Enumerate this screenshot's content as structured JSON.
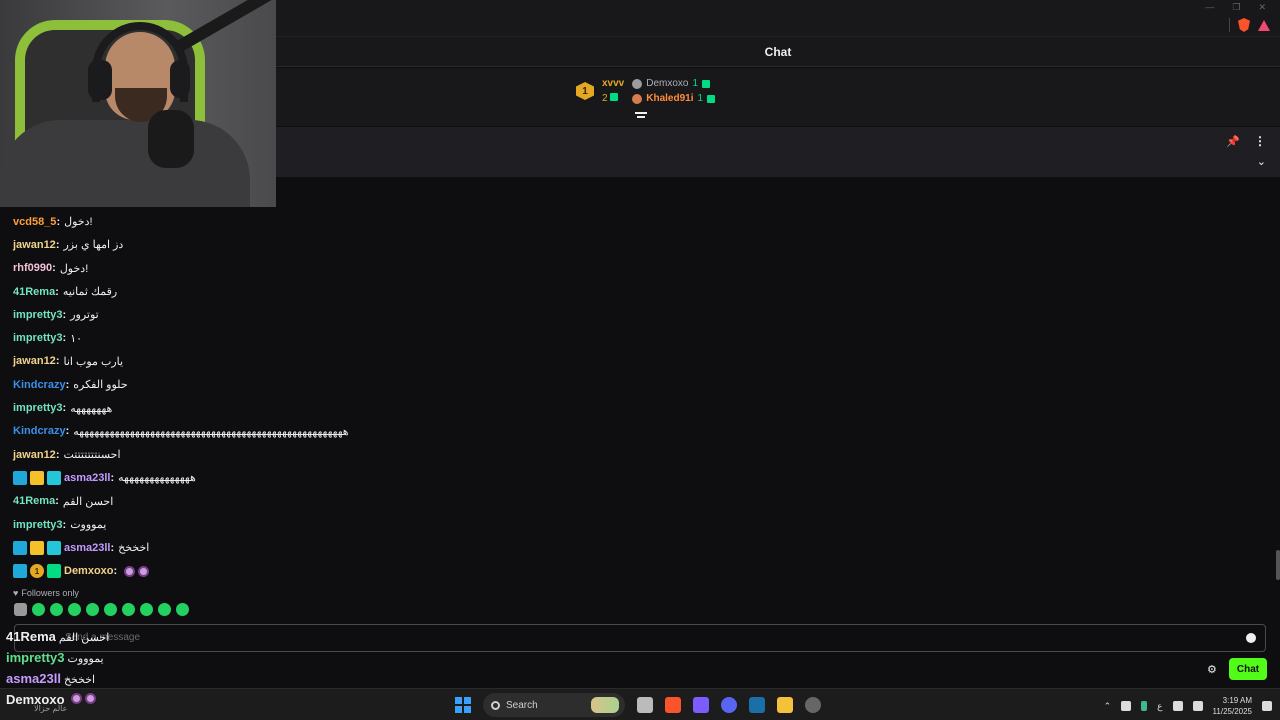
{
  "browser": {
    "window_controls": [
      "—",
      "❐",
      "✕"
    ]
  },
  "chat": {
    "title": "Chat",
    "leaderboard": {
      "first": {
        "rank": "1",
        "name": "xvvv",
        "count": "2"
      },
      "others": [
        {
          "name": "Demxoxo",
          "count": "1"
        },
        {
          "name": "Khaled91i",
          "count": "1"
        }
      ]
    },
    "messages": [
      {
        "user": "vcd58_5",
        "color": "#ff9d3a",
        "text": "دخول!"
      },
      {
        "user": "jawan12",
        "color": "#f2d38c",
        "text": "دز امها ي بزر"
      },
      {
        "user": "rhf0990",
        "color": "#f4c2d9",
        "text": "دخول!"
      },
      {
        "user": "41Rema",
        "color": "#74e3c4",
        "text": "رقمك ثمانيه"
      },
      {
        "user": "impretty3",
        "color": "#74e3c4",
        "text": "توترور"
      },
      {
        "user": "impretty3",
        "color": "#74e3c4",
        "text": "١٠"
      },
      {
        "user": "jawan12",
        "color": "#f2d38c",
        "text": "يارب موب انا"
      },
      {
        "user": "Kindcrazy",
        "color": "#3a8fe8",
        "text": "حلوو الفكره"
      },
      {
        "user": "impretty3",
        "color": "#74e3c4",
        "text": "هههههههه"
      },
      {
        "user": "Kindcrazy",
        "color": "#3a8fe8",
        "text": "هههههههههههههههههههههههههههههههههههههههههههههههههههههه"
      },
      {
        "user": "jawan12",
        "color": "#f2d38c",
        "text": "احسنتتتتتتتت"
      },
      {
        "user": "asma23ll",
        "color": "#c49bff",
        "text": "ههههههههههههههه",
        "badges": [
          "mod",
          "crown",
          "vip"
        ]
      },
      {
        "user": "41Rema",
        "color": "#74e3c4",
        "text": "احسن القم"
      },
      {
        "user": "impretty3",
        "color": "#74e3c4",
        "text": "يموووت"
      },
      {
        "user": "asma23ll",
        "color": "#c49bff",
        "text": "اخخخخ",
        "badges": [
          "mod",
          "crown",
          "vip"
        ]
      },
      {
        "user": "Demxoxo",
        "color": "#f2d38c",
        "text": "",
        "badges": [
          "mod",
          "sub",
          "gift"
        ],
        "emotes": 2
      }
    ],
    "sub_badge_label": "1",
    "followers_only": "Followers only",
    "input_placeholder": "Send a message",
    "send_button": "Chat"
  },
  "overlay": {
    "lines": [
      {
        "user": "41Rema",
        "color": "#efeff1",
        "text": "احسن القم"
      },
      {
        "user": "impretty3",
        "color": "#5fe08c",
        "text": "يموووت"
      },
      {
        "user": "asma23ll",
        "color": "#c49bff",
        "text": "اخخخخ"
      },
      {
        "user": "Demxoxo",
        "color": "#efeff1",
        "text": ""
      }
    ],
    "sub_caption": "عالم حزالا"
  },
  "taskbar": {
    "search_label": "Search",
    "time": "3:19 AM",
    "date": "11/25/2025",
    "lang": "ع"
  }
}
